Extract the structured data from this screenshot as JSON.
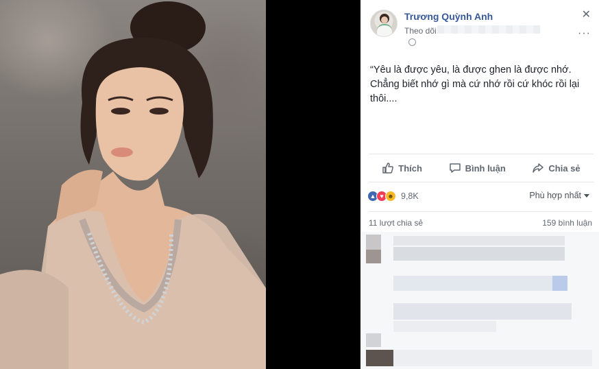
{
  "post": {
    "author": "Trương Quỳnh Anh",
    "follow_label": "Theo dõi",
    "text": "“Yêu là được yêu, là được ghen là được nhớ. Chẳng biết nhớ gì mà cứ nhớ rồi cứ khóc rồi lại thôi....",
    "close_symbol": "✕",
    "more_symbol": "···"
  },
  "actions": {
    "like": "Thích",
    "comment": "Bình luận",
    "share": "Chia sẻ"
  },
  "reactions": {
    "count": "9,8K",
    "sort_label": "Phù hợp nhất"
  },
  "stats": {
    "shares": "11 lượt chia sẻ",
    "comments": "159 bình luận"
  },
  "colors": {
    "link": "#365899",
    "like": "#4267b2",
    "love": "#f33e58",
    "haha": "#f7b928"
  },
  "icons": {
    "like": "thumbs-up-icon",
    "comment": "speech-bubble-icon",
    "share": "share-arrow-icon",
    "privacy": "globe-icon"
  }
}
